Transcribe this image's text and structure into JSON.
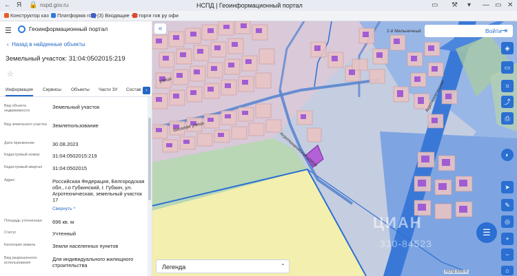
{
  "browser": {
    "url": "nspd.gov.ru",
    "window_title": "НСПД | Геоинформационный портал",
    "bookmarks": [
      "Конструктор каз",
      "Платформа госу",
      "(3) Входящие - П",
      "торги гов ру офи"
    ]
  },
  "panel": {
    "portal_title": "Геоинформационный портал",
    "back_link": "Назад в найденные объекты",
    "object_title": "Земельный участок: 31:04:0502015:219",
    "tabs": [
      "Информация",
      "Сервисы",
      "Объекты",
      "Части ЗУ",
      "Состав"
    ],
    "fields": [
      {
        "label": "Вид объекта недвижимости",
        "value": "Земельный участок"
      },
      {
        "label": "Вид земельного участка",
        "value": "Землепользование"
      },
      {
        "label": "Дата присвоения",
        "value": "30.08.2023"
      },
      {
        "label": "Кадастровый номер",
        "value": "31:04:0502015:219"
      },
      {
        "label": "Кадастровый квартал",
        "value": "31:04:0502015"
      },
      {
        "label": "Адрес",
        "value": "Российская Федерация, Белгородская обл., г.о Губкинский, г. Губкин, ул. Агротехническая, земельный участок 17"
      },
      {
        "label": "Площадь уточненная",
        "value": "696 кв. м"
      },
      {
        "label": "Статус",
        "value": "Учтенный"
      },
      {
        "label": "Категория земель",
        "value": "Земли населенных пунктов"
      },
      {
        "label": "Вид разрешенного использования",
        "value": "Для индивидуального жилищного строительства"
      }
    ],
    "collapse_label": "Свернуть"
  },
  "map": {
    "login_label": "Войти",
    "legend_label": "Легенда",
    "street_labels": [
      "2-й Мельничный",
      "Агротехническая",
      "Веселая улица",
      "улица",
      "Агротехническая улица"
    ],
    "watermark": "ЦИАН",
    "watermark_phone": "330-84523",
    "attribution": "НСПД 2006 ©",
    "colors": {
      "parcel_fill": "#e9c4c4",
      "building": "#9b52d6",
      "zone_blue": "#6d9ee0",
      "selected": "#8e2db5",
      "yellow_zone": "#f3efae"
    }
  }
}
